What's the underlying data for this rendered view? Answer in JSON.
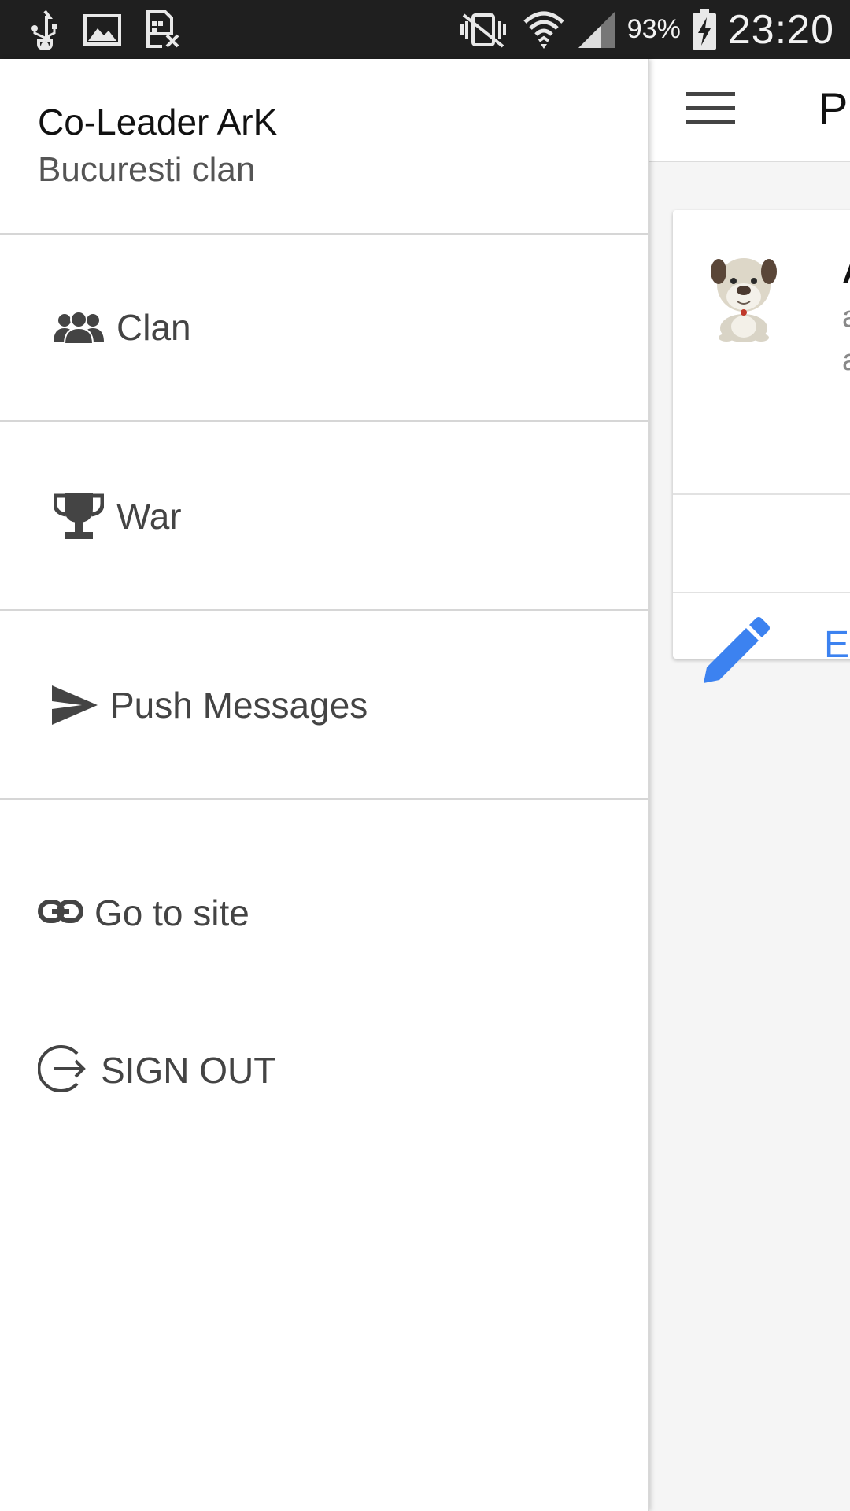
{
  "status_bar": {
    "battery_percent": "93%",
    "time": "23:20",
    "left_icons": [
      "usb-icon",
      "image-icon",
      "sim-card-x-icon"
    ],
    "right_icons": [
      "vibrate-mute-icon",
      "wifi-icon",
      "signal-icon",
      "battery-charging-icon"
    ]
  },
  "drawer": {
    "user_name": "Co-Leader ArK",
    "clan_name": "Bucuresti clan",
    "items": [
      {
        "label": "Clan",
        "icon": "group-icon"
      },
      {
        "label": "War",
        "icon": "trophy-icon"
      },
      {
        "label": "Push Messages",
        "icon": "send-icon"
      }
    ],
    "links": [
      {
        "label": "Go to site",
        "icon": "link-icon"
      },
      {
        "label": "SIGN OUT",
        "icon": "sign-out-icon"
      }
    ]
  },
  "background_app": {
    "title_partial": "P",
    "card_name_partial": "A",
    "card_line1_partial": "a",
    "card_line2_partial": "a",
    "edit_label_partial": "Edi",
    "accent_color": "#3c82f0"
  }
}
